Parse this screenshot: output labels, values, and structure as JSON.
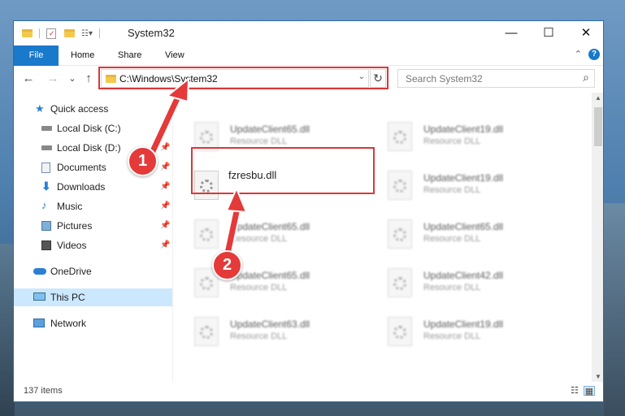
{
  "window": {
    "title": "System32",
    "controls": {
      "minimize": "—",
      "maximize": "☐",
      "close": "✕"
    }
  },
  "ribbon": {
    "tabs": [
      "File",
      "Home",
      "Share",
      "View"
    ],
    "help": "?",
    "collapse": "⌃"
  },
  "navigation": {
    "back": "←",
    "forward": "→",
    "recent": "⌄",
    "up": "↑",
    "address": "C:\\Windows\\System32",
    "address_dropdown": "⌄",
    "refresh": "↻",
    "search_placeholder": "Search System32",
    "search_icon": "⌕"
  },
  "sidebar": {
    "items": [
      {
        "label": "Quick access",
        "icon": "star-icon",
        "pinned": false
      },
      {
        "label": "Local Disk (C:)",
        "icon": "drive-icon",
        "pinned": true
      },
      {
        "label": "Local Disk (D:)",
        "icon": "drive-icon",
        "pinned": true
      },
      {
        "label": "Documents",
        "icon": "documents-icon",
        "pinned": true
      },
      {
        "label": "Downloads",
        "icon": "download-icon",
        "pinned": true
      },
      {
        "label": "Music",
        "icon": "music-icon",
        "pinned": true
      },
      {
        "label": "Pictures",
        "icon": "pictures-icon",
        "pinned": true
      },
      {
        "label": "Videos",
        "icon": "videos-icon",
        "pinned": true
      },
      {
        "label": "OneDrive",
        "icon": "cloud-icon",
        "pinned": false
      },
      {
        "label": "This PC",
        "icon": "computer-icon",
        "pinned": false,
        "selected": true
      },
      {
        "label": "Network",
        "icon": "network-icon",
        "pinned": false
      }
    ],
    "pin_glyph": "📌"
  },
  "files": [
    {
      "name": "UpdateClient65.dll",
      "type": "Resource DLL",
      "blurred": true
    },
    {
      "name": "UpdateClient19.dll",
      "type": "Resource DLL",
      "blurred": true
    },
    {
      "name": "fzresbu.dll",
      "type": "",
      "blurred": false,
      "highlighted": true
    },
    {
      "name": "UpdateClient19.dll",
      "type": "Resource DLL",
      "blurred": true
    },
    {
      "name": "UpdateClient65.dll",
      "type": "Resource DLL",
      "blurred": true
    },
    {
      "name": "UpdateClient65.dll",
      "type": "Resource DLL",
      "blurred": true
    },
    {
      "name": "UpdateClient65.dll",
      "type": "Resource DLL",
      "blurred": true
    },
    {
      "name": "UpdateClient42.dll",
      "type": "Resource DLL",
      "blurred": true
    },
    {
      "name": "UpdateClient63.dll",
      "type": "Resource DLL",
      "blurred": true
    },
    {
      "name": "UpdateClient19.dll",
      "type": "Resource DLL",
      "blurred": true
    }
  ],
  "status": {
    "item_count": "137 items"
  },
  "annotations": {
    "step1": "1",
    "step2": "2",
    "color": "#e43a3a"
  },
  "scroll": {
    "up": "▲",
    "down": "▼"
  }
}
